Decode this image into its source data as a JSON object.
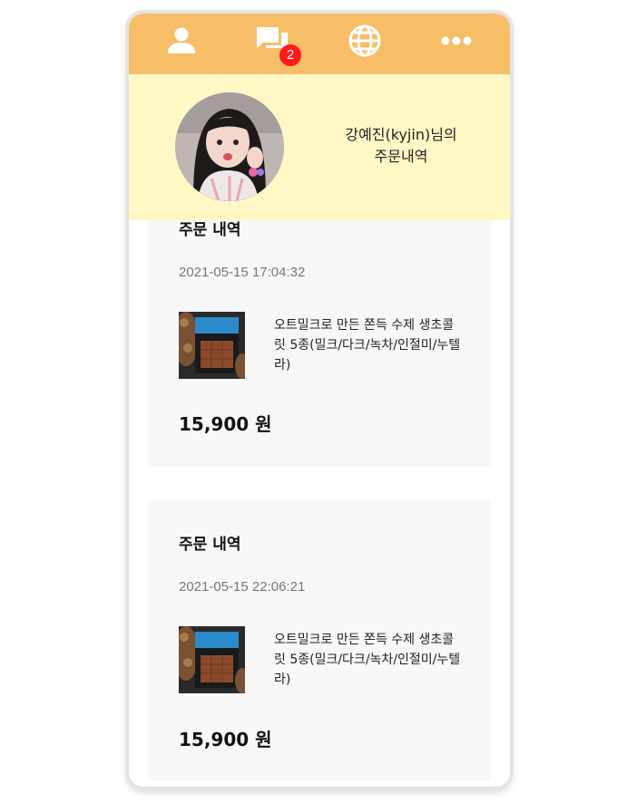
{
  "nav": {
    "items": [
      "user-icon",
      "chat-icon",
      "globe-icon",
      "more-icon"
    ],
    "chat_badge": "2",
    "bar_color": "#f7be68"
  },
  "profile": {
    "title_line1": "강예진(kyjin)님의",
    "title_line2": "주문내역",
    "bg_color": "#fff8c5"
  },
  "orders": [
    {
      "title": "주문 내역",
      "date": "2021-05-15 17:04:32",
      "item_name": "오트밀크로 만든 쫀득 수제 생초콜릿 5종(밀크/다크/녹차/인절미/누텔라)",
      "price": "15,900 원"
    },
    {
      "title": "주문 내역",
      "date": "2021-05-15 22:06:21",
      "item_name": "오트밀크로 만든 쫀득 수제 생초콜릿 5종(밀크/다크/녹차/인절미/누텔라)",
      "price": "15,900 원"
    }
  ]
}
